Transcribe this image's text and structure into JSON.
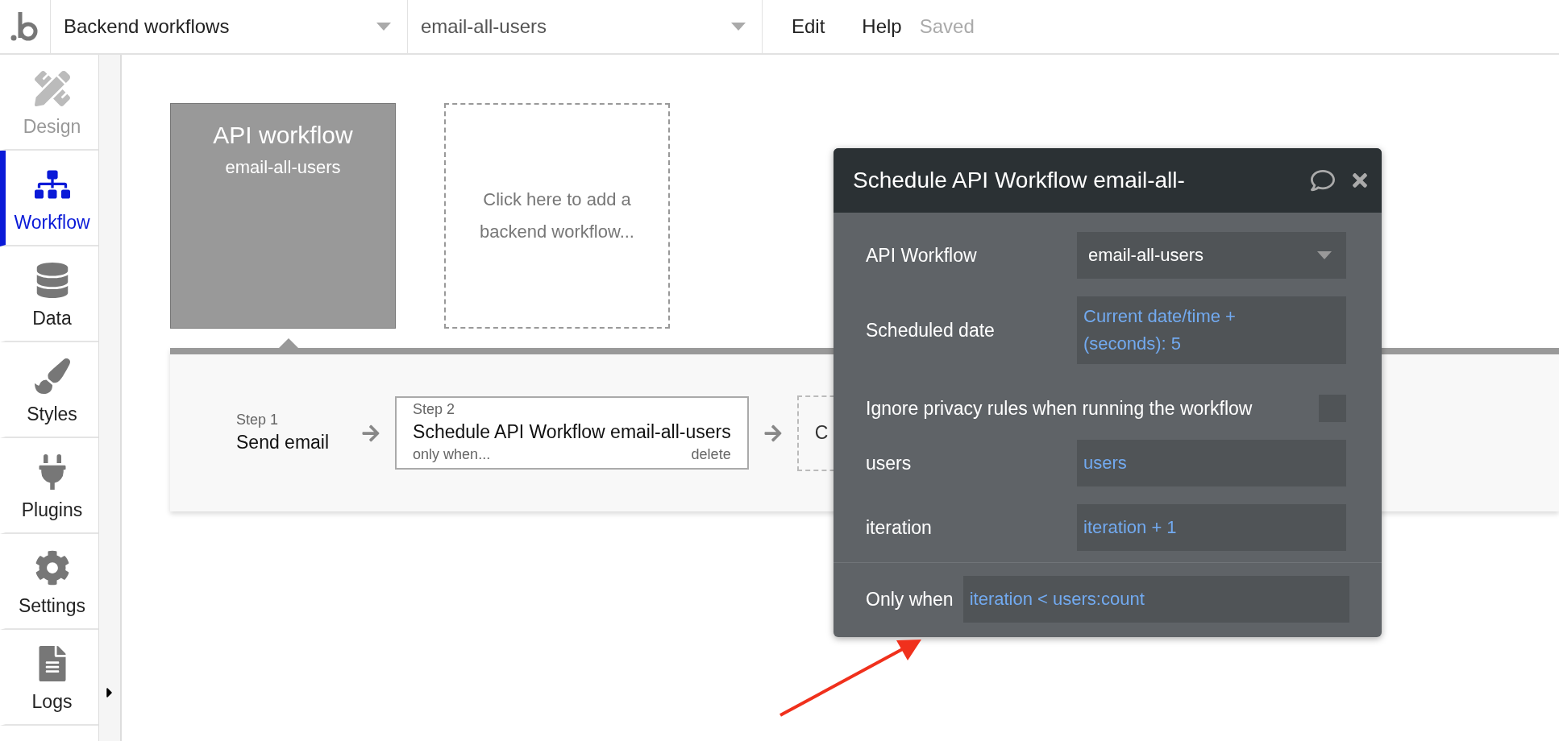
{
  "topbar": {
    "page_dropdown": "Backend workflows",
    "workflow_dropdown": "email-all-users",
    "menu": [
      "Edit",
      "Help"
    ],
    "status": "Saved"
  },
  "sidebar": {
    "items": [
      {
        "label": "Design",
        "selected": false,
        "disabled": true
      },
      {
        "label": "Workflow",
        "selected": true,
        "disabled": false
      },
      {
        "label": "Data",
        "selected": false,
        "disabled": false
      },
      {
        "label": "Styles",
        "selected": false,
        "disabled": false
      },
      {
        "label": "Plugins",
        "selected": false,
        "disabled": false
      },
      {
        "label": "Settings",
        "selected": false,
        "disabled": false
      },
      {
        "label": "Logs",
        "selected": false,
        "disabled": false
      }
    ]
  },
  "canvas": {
    "workflow_card": {
      "title": "API workflow",
      "subtitle": "email-all-users"
    },
    "add_card": {
      "text": "Click here to add a backend workflow..."
    },
    "steps": [
      {
        "kind": "step",
        "label": "Step 1",
        "title": "Send email"
      },
      {
        "kind": "step",
        "label": "Step 2",
        "title": "Schedule API Workflow email-all-users",
        "condition": "only when...",
        "action": "delete",
        "selected": true
      },
      {
        "kind": "add",
        "text": "C"
      }
    ]
  },
  "dialog": {
    "title": "Schedule API Workflow email-all-",
    "rows": [
      {
        "kind": "dropdown",
        "label": "API Workflow",
        "value": "email-all-users"
      },
      {
        "kind": "expression",
        "label": "Scheduled date",
        "value": "Current date/time + (seconds): 5"
      },
      {
        "kind": "checkbox",
        "label": "Ignore privacy rules when running the workflow",
        "checked": false
      },
      {
        "kind": "expression",
        "label": "users",
        "value": "users"
      },
      {
        "kind": "expression",
        "label": "iteration",
        "value": "iteration + 1"
      }
    ],
    "condition": {
      "label": "Only when",
      "value": "iteration < users:count"
    }
  }
}
